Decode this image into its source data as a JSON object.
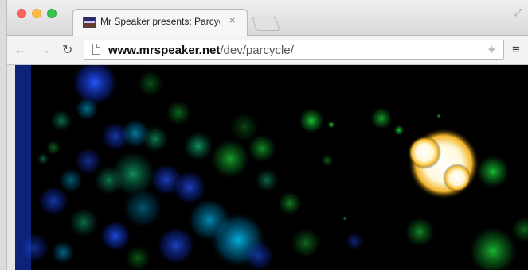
{
  "window": {
    "tab": {
      "title": "Mr Speaker presents: Parcyc",
      "close_glyph": "×",
      "favicon": "page-favicon"
    },
    "new_tab": "new-tab",
    "fullscreen_glyph": "⤢"
  },
  "toolbar": {
    "back_glyph": "←",
    "forward_glyph": "→",
    "reload_glyph": "↻",
    "menu_glyph": "≡",
    "bookmark_glyph": "✦"
  },
  "address": {
    "host": "www.mrspeaker.net",
    "path": "/dev/parcycle/"
  },
  "content": {
    "background": "#000000",
    "particle_colors": [
      "#1a3dff",
      "#00a8ff",
      "#00c8ff",
      "#18d82a",
      "#13c56f",
      "#ffffff",
      "#ffd84f"
    ]
  }
}
